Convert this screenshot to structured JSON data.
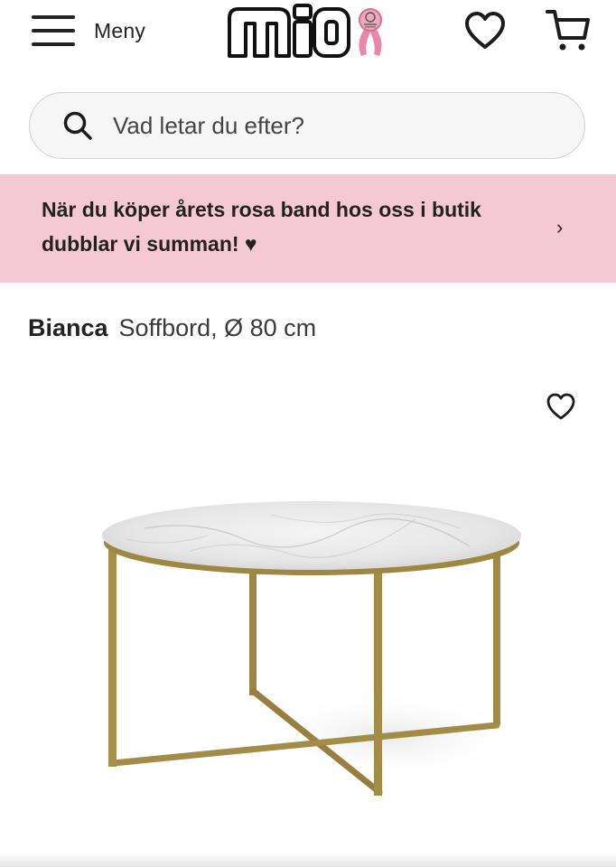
{
  "header": {
    "menu_label": "Meny",
    "logo_text": "mio",
    "icons": {
      "menu": "hamburger-icon",
      "logo_badge": "pink-ribbon-icon",
      "wishlist": "heart-icon",
      "cart": "shopping-cart-icon"
    }
  },
  "search": {
    "placeholder": "Vad letar du efter?",
    "icon": "search-icon"
  },
  "promo": {
    "text": "När du köper årets rosa band hos oss i butik dubblar vi summan! ♥",
    "icon": "chevron-right-icon",
    "background": "#f5c9d3"
  },
  "product": {
    "name": "Bianca",
    "description": "Soffbord, Ø 80 cm",
    "wishlist_icon": "heart-icon",
    "image": "coffee-table-photo"
  },
  "colors": {
    "accent_pink": "#f5c9d3",
    "ribbon_pink": "#e887a6",
    "table_frame_gold": "#a08a46"
  }
}
